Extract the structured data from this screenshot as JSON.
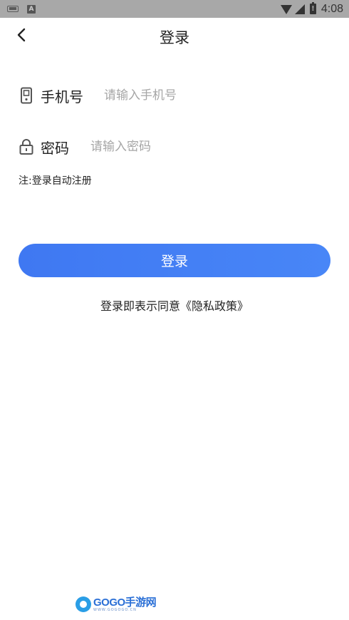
{
  "status_bar": {
    "time": "4:08",
    "notification_icon_letter": "A"
  },
  "header": {
    "title": "登录",
    "back_icon": "chevron-left-icon"
  },
  "form": {
    "phone": {
      "icon": "phone-icon",
      "label": "手机号",
      "placeholder": "请输入手机号",
      "value": ""
    },
    "password": {
      "icon": "lock-icon",
      "label": "密码",
      "placeholder": "请输入密码",
      "value": ""
    },
    "note": "注:登录自动注册"
  },
  "login_button": {
    "label": "登录",
    "color_start": "#3f78f2",
    "color_end": "#4886f7"
  },
  "agreement": {
    "prefix": "登录即表示同意",
    "policy_link": "《隐私政策》"
  },
  "watermark": {
    "brand_latin": "GOGO",
    "brand_cn": "手游网",
    "url": "WWW.GOGOGO.CN"
  }
}
